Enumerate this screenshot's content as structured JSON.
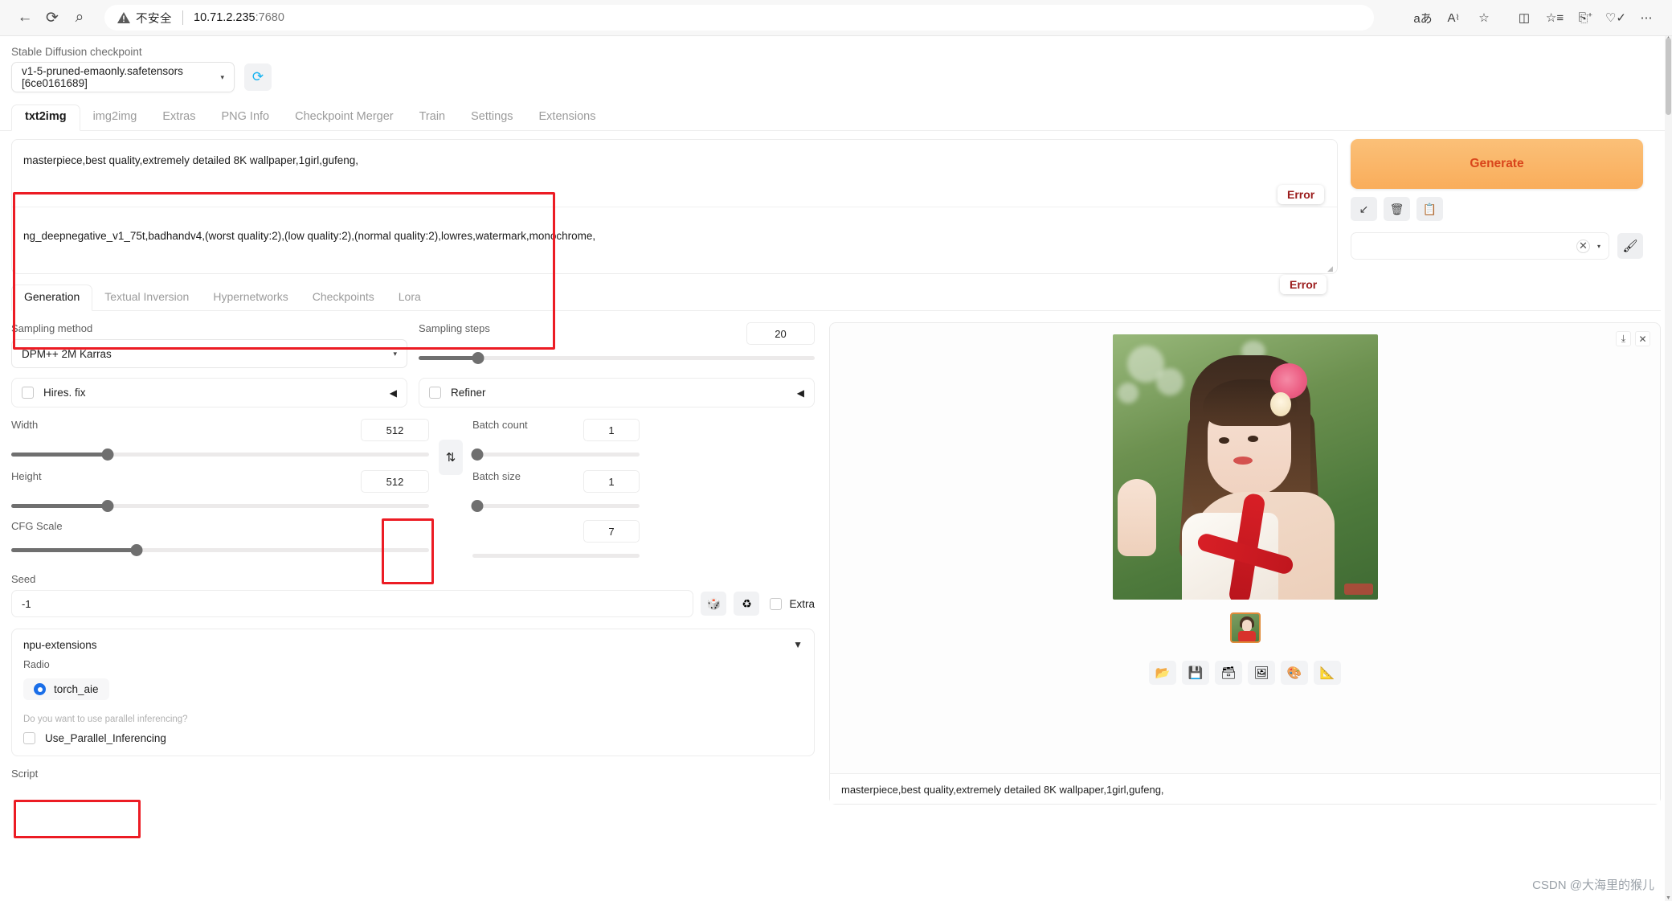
{
  "browser": {
    "back_icon": "back-arrow-icon",
    "reload_icon": "reload-icon",
    "search_icon": "search-icon",
    "security_label": "不安全",
    "url_host": "10.71.2.235",
    "url_port": ":7680",
    "right_icons": [
      "translate-icon",
      "read-aloud-icon",
      "favorite-star-icon",
      "split-screen-icon",
      "collections-icon",
      "add-to-favorites-icon",
      "browser-essentials-icon",
      "settings-more-icon"
    ]
  },
  "checkpoint": {
    "label": "Stable Diffusion checkpoint",
    "value": "v1-5-pruned-emaonly.safetensors [6ce0161689]",
    "caret": "▾",
    "refresh_icon": "refresh-icon"
  },
  "main_tabs": [
    {
      "label": "txt2img",
      "active": true
    },
    {
      "label": "img2img",
      "active": false
    },
    {
      "label": "Extras",
      "active": false
    },
    {
      "label": "PNG Info",
      "active": false
    },
    {
      "label": "Checkpoint Merger",
      "active": false
    },
    {
      "label": "Train",
      "active": false
    },
    {
      "label": "Settings",
      "active": false
    },
    {
      "label": "Extensions",
      "active": false
    }
  ],
  "prompt": {
    "positive": "masterpiece,best quality,extremely detailed 8K wallpaper,1girl,gufeng,",
    "negative": "ng_deepnegative_v1_75t,badhandv4,(worst quality:2),(low quality:2),(normal quality:2),lowres,watermark,monochrome,",
    "error_badge_1": "Error",
    "error_badge_2": "Error"
  },
  "actions": {
    "generate_label": "Generate",
    "arrow_btn_icon": "paste-arrow-icon",
    "trash_btn_icon": "trash-icon",
    "clipboard_btn_icon": "clipboard-icon",
    "styles_value": "",
    "styles_clear_icon": "clear-x-icon",
    "styles_caret": "▾",
    "brush_btn_icon": "paintbrush-icon"
  },
  "sub_tabs": [
    {
      "label": "Generation",
      "active": true
    },
    {
      "label": "Textual Inversion",
      "active": false
    },
    {
      "label": "Hypernetworks",
      "active": false
    },
    {
      "label": "Checkpoints",
      "active": false
    },
    {
      "label": "Lora",
      "active": false
    }
  ],
  "settings": {
    "sampling_method_label": "Sampling method",
    "sampling_method_value": "DPM++ 2M Karras",
    "sampling_steps_label": "Sampling steps",
    "sampling_steps_value": "20",
    "hires_fix_label": "Hires. fix",
    "refiner_label": "Refiner",
    "width_label": "Width",
    "width_value": "512",
    "height_label": "Height",
    "height_value": "512",
    "swap_icon": "swap-dimensions-icon",
    "cfg_label": "CFG Scale",
    "cfg_value": "7",
    "batch_count_label": "Batch count",
    "batch_count_value": "1",
    "batch_size_label": "Batch size",
    "batch_size_value": "1",
    "seed_label": "Seed",
    "seed_value": "-1",
    "seed_dice_icon": "dice-icon",
    "seed_recycle_icon": "recycle-icon",
    "extra_label": "Extra"
  },
  "npu": {
    "title": "npu-extensions",
    "caret": "▼",
    "radio_label": "Radio",
    "radio_option": "torch_aie",
    "hint": "Do you want to use parallel inferencing?",
    "parallel_checkbox_label": "Use_Parallel_Inferencing",
    "script_label": "Script"
  },
  "output": {
    "download_icon": "download-icon",
    "close_icon": "close-x-icon",
    "toolbar_icons": [
      "folder-icon",
      "save-icon",
      "save-zip-icon",
      "send-to-img2img-icon",
      "send-to-inpaint-icon",
      "send-to-extras-icon"
    ],
    "caption": "masterpiece,best quality,extremely detailed 8K wallpaper,1girl,gufeng,"
  },
  "watermark": "CSDN @大海里的猴儿",
  "colors": {
    "accent_orange": "#f9ad5b",
    "error_red": "#9b1c1c",
    "outline_red": "#ec1c24",
    "radio_blue": "#1a6ee8"
  }
}
